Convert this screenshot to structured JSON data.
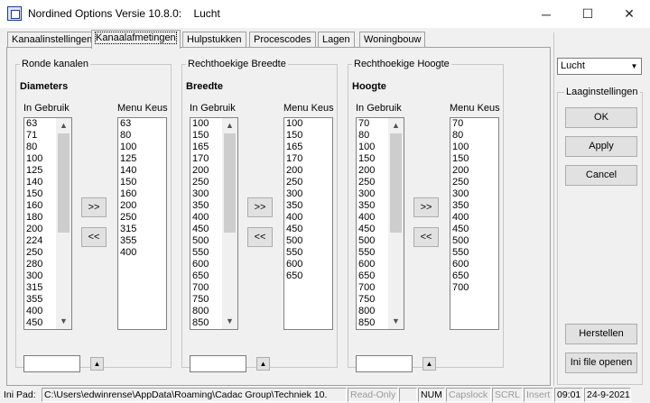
{
  "window": {
    "title": "Nordined Options Versie 10.8.0:    Lucht",
    "minimize": "─",
    "maximize": "☐",
    "close": "✕"
  },
  "tabs": [
    "Kanaalinstellingen",
    "Kanaalafmetingen",
    "Hulpstukken",
    "Procescodes",
    "Lagen",
    "Woningbouw"
  ],
  "groups": [
    {
      "title": "Ronde kanalen",
      "subtitle": "Diameters",
      "in_label": "In Gebruik",
      "menu_label": "Menu Keus",
      "in_use": [
        "63",
        "71",
        "80",
        "100",
        "125",
        "140",
        "150",
        "160",
        "180",
        "200",
        "224",
        "250",
        "280",
        "300",
        "315",
        "355",
        "400",
        "450"
      ],
      "menu": [
        "63",
        "80",
        "100",
        "125",
        "140",
        "150",
        "160",
        "200",
        "250",
        "315",
        "355",
        "400"
      ]
    },
    {
      "title": "Rechthoekige Breedte",
      "subtitle": "Breedte",
      "in_label": "In Gebruik",
      "menu_label": "Menu Keus",
      "in_use": [
        "100",
        "150",
        "165",
        "170",
        "200",
        "250",
        "300",
        "350",
        "400",
        "450",
        "500",
        "550",
        "600",
        "650",
        "700",
        "750",
        "800",
        "850"
      ],
      "menu": [
        "100",
        "150",
        "165",
        "170",
        "200",
        "250",
        "300",
        "350",
        "400",
        "450",
        "500",
        "550",
        "600",
        "650"
      ]
    },
    {
      "title": "Rechthoekige Hoogte",
      "subtitle": "Hoogte",
      "in_label": "In Gebruik",
      "menu_label": "Menu Keus",
      "in_use": [
        "70",
        "80",
        "100",
        "150",
        "200",
        "250",
        "300",
        "350",
        "400",
        "450",
        "500",
        "550",
        "600",
        "650",
        "700",
        "750",
        "800",
        "850"
      ],
      "menu": [
        "70",
        "80",
        "100",
        "150",
        "200",
        "250",
        "300",
        "350",
        "400",
        "450",
        "500",
        "550",
        "600",
        "650",
        "700"
      ]
    }
  ],
  "move_right": ">>",
  "move_left": "<<",
  "spin_up": "▲",
  "scroll_up": "▲",
  "scroll_down": "▼",
  "combo": {
    "value": "Lucht",
    "arrow": "▼"
  },
  "right_group": {
    "title": "Laaginstellingen"
  },
  "buttons": {
    "ok": "OK",
    "apply": "Apply",
    "cancel": "Cancel",
    "restore": "Herstellen",
    "ini_open": "Ini file openen"
  },
  "status": {
    "label": "Ini Pad:",
    "path": "C:\\Users\\edwinrense\\AppData\\Roaming\\Cadac Group\\Techniek 10.",
    "readonly": "Read-Only",
    "num": "NUM",
    "caps": "Capslock",
    "scrl": "SCRL",
    "ins": "Insert",
    "time": "09:01",
    "date": "24-9-2021"
  }
}
